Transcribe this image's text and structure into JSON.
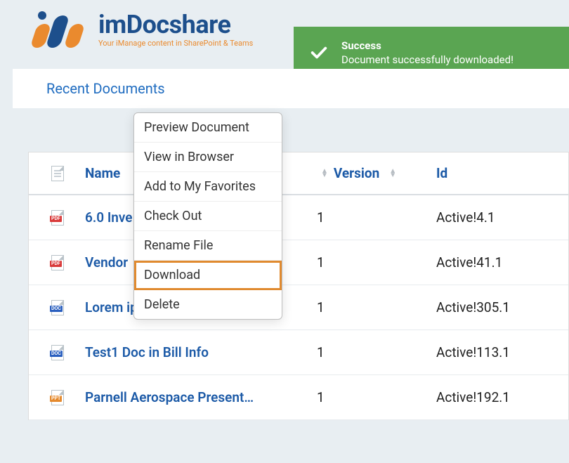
{
  "brand": {
    "word": "imDocshare",
    "tagline": "Your iManage content in SharePoint & Teams"
  },
  "toast": {
    "title": "Success",
    "message": "Document successfully downloaded!"
  },
  "panel": {
    "title": "Recent Documents"
  },
  "table": {
    "columns": {
      "name": "Name",
      "version": "Version",
      "id": "Id"
    },
    "rows": [
      {
        "icon": "pdf",
        "icon_label": "PDF",
        "name": "6.0 Inve",
        "version": "1",
        "id": "Active!4.1"
      },
      {
        "icon": "pdf",
        "icon_label": "PDF",
        "name": "Vendor",
        "version": "1",
        "id": "Active!41.1"
      },
      {
        "icon": "doc",
        "icon_label": "DOC",
        "name": "Lorem ip",
        "version": "1",
        "id": "Active!305.1"
      },
      {
        "icon": "doc",
        "icon_label": "DOC",
        "name": "Test1 Doc in Bill Info",
        "version": "1",
        "id": "Active!113.1"
      },
      {
        "icon": "ppt",
        "icon_label": "PPT",
        "name": "Parnell Aerospace Present…",
        "version": "1",
        "id": "Active!192.1"
      }
    ]
  },
  "context_menu": {
    "items": [
      {
        "label": "Preview Document"
      },
      {
        "label": "View in Browser"
      },
      {
        "label": "Add to My Favorites"
      },
      {
        "label": "Check Out",
        "pointer": true
      },
      {
        "label": "Rename File"
      },
      {
        "label": "Download",
        "highlighted": true
      },
      {
        "label": "Delete"
      }
    ]
  }
}
